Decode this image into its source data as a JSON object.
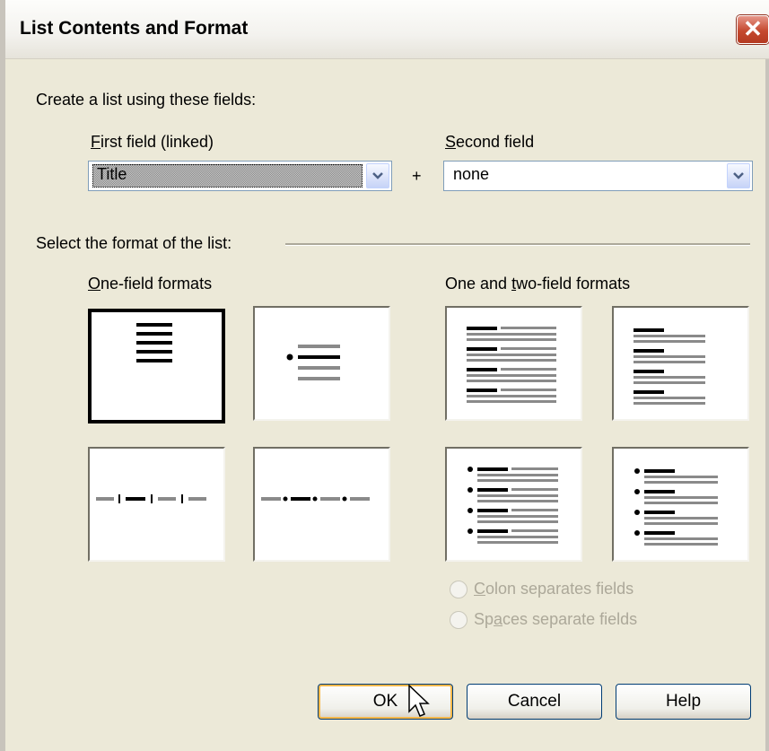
{
  "dialog": {
    "title": "List Contents and Format",
    "close_icon": "close-icon"
  },
  "fields": {
    "create_label": "Create a list using these fields:",
    "first_label_mnemonic": "F",
    "first_label_rest": "irst field (linked)",
    "first_value": "Title",
    "plus": "+",
    "second_label_mnemonic": "S",
    "second_label_rest": "econd field",
    "second_value": "none"
  },
  "format": {
    "section_label": "Select the format of the list:",
    "one_field_mnemonic": "O",
    "one_field_rest": "ne-field formats",
    "two_field_pre": "One and ",
    "two_field_mnemonic": "t",
    "two_field_rest": "wo-field formats",
    "selected_tile": "one-field-list"
  },
  "options": {
    "colon_mnemonic": "C",
    "colon_rest": "olon separates fields",
    "spaces_pre": "Sp",
    "spaces_mnemonic": "a",
    "spaces_rest": "ces separate fields"
  },
  "buttons": {
    "ok": "OK",
    "cancel": "Cancel",
    "help": "Help"
  }
}
